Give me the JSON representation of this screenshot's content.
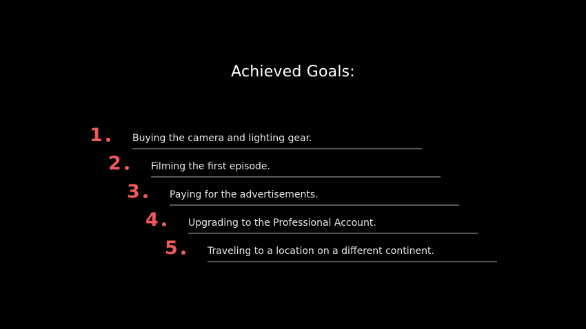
{
  "slide": {
    "title": "Achieved Goals:",
    "accent_color": "#f15a5a",
    "goals": [
      {
        "number": "1",
        "text": "Buying the camera and lighting gear."
      },
      {
        "number": "2",
        "text": "Filming the first episode."
      },
      {
        "number": "3",
        "text": "Paying for the advertisements."
      },
      {
        "number": "4",
        "text": "Upgrading to the Professional Account."
      },
      {
        "number": "5",
        "text": "Traveling to a location on a different continent."
      }
    ]
  }
}
